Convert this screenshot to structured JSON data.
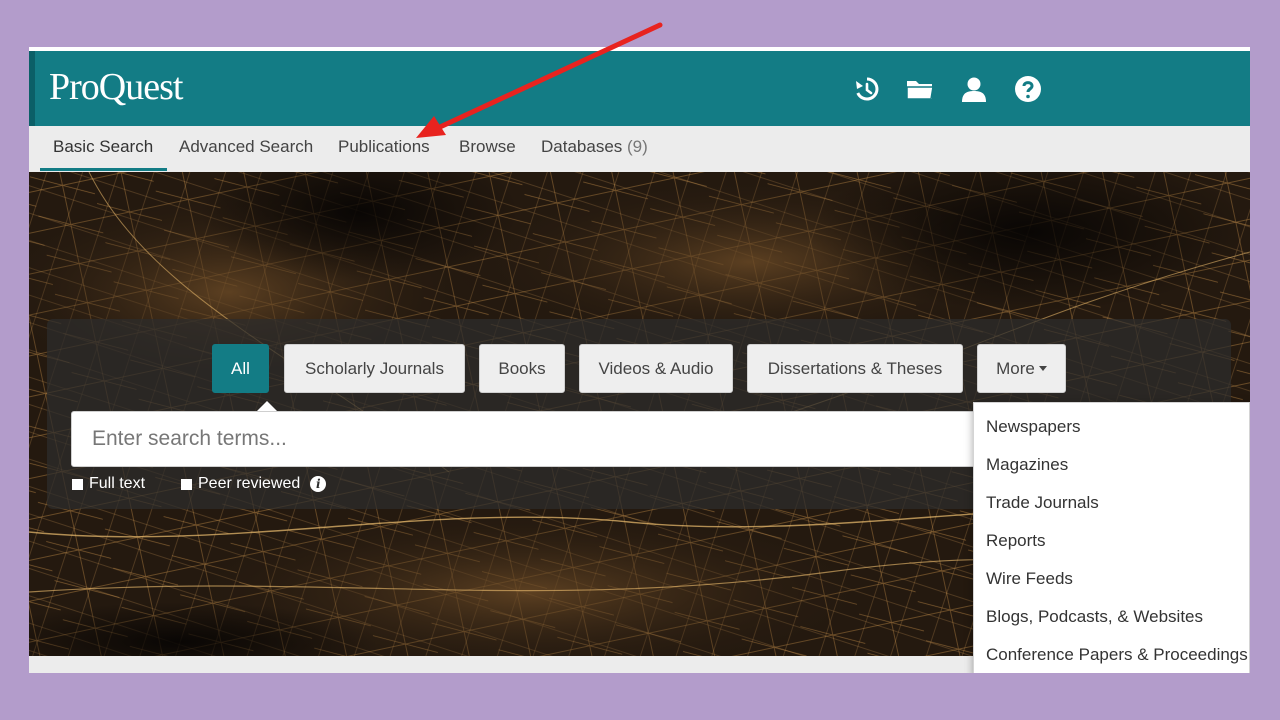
{
  "app": {
    "logo": "ProQuest"
  },
  "header": {
    "icons": [
      "history-icon",
      "folder-icon",
      "user-icon",
      "help-icon"
    ],
    "color": "#137c85"
  },
  "nav": {
    "items": [
      {
        "label": "Basic Search",
        "active": true
      },
      {
        "label": "Advanced Search"
      },
      {
        "label": "Publications"
      },
      {
        "label": "Browse"
      },
      {
        "label": "Databases",
        "count": "(9)"
      }
    ]
  },
  "search": {
    "tabs": [
      {
        "label": "All",
        "active": true
      },
      {
        "label": "Scholarly Journals"
      },
      {
        "label": "Books"
      },
      {
        "label": "Videos & Audio"
      },
      {
        "label": "Dissertations & Theses"
      },
      {
        "label": "More"
      }
    ],
    "placeholder": "Enter search terms...",
    "checkboxes": [
      {
        "label": "Full text"
      },
      {
        "label": "Peer reviewed"
      }
    ]
  },
  "more_menu": {
    "items": [
      "Newspapers",
      "Magazines",
      "Trade Journals",
      "Reports",
      "Wire Feeds",
      "Blogs, Podcasts, & Websites",
      "Conference Papers & Proceedings"
    ]
  },
  "annotation": {
    "arrow_color": "#e8231f"
  }
}
